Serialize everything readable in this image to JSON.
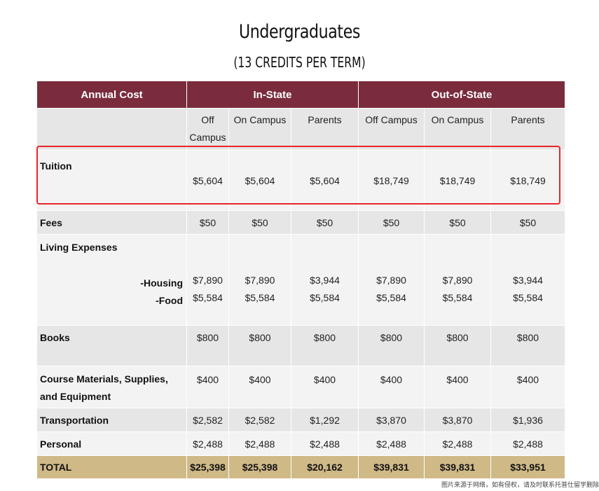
{
  "title": "Undergraduates",
  "subtitle": "(13 CREDITS PER TERM)",
  "header": {
    "annual_cost": "Annual Cost",
    "in_state": "In-State",
    "out_of_state": "Out-of-State"
  },
  "subheader": [
    "Off Campus",
    "On Campus",
    "Parents",
    "Off Campus",
    "On Campus",
    "Parents"
  ],
  "rows": {
    "tuition": {
      "label": "Tuition",
      "values": [
        "$5,604",
        "$5,604",
        "$5,604",
        "$18,749",
        "$18,749",
        "$18,749"
      ]
    },
    "fees": {
      "label": "Fees",
      "values": [
        "$50",
        "$50",
        "$50",
        "$50",
        "$50",
        "$50"
      ]
    },
    "living": {
      "label": "Living Expenses",
      "housing_label": "-Housing",
      "housing": [
        "$7,890",
        "$7,890",
        "$3,944",
        "$7,890",
        "$7,890",
        "$3,944"
      ],
      "food_label": "-Food",
      "food": [
        "$5,584",
        "$5,584",
        "$5,584",
        "$5,584",
        "$5,584",
        "$5,584"
      ]
    },
    "books": {
      "label": "Books",
      "values": [
        "$800",
        "$800",
        "$800",
        "$800",
        "$800",
        "$800"
      ]
    },
    "materials": {
      "label_line1": "Course Materials, Supplies,",
      "label_line2": "and Equipment",
      "values": [
        "$400",
        "$400",
        "$400",
        "$400",
        "$400",
        "$400"
      ]
    },
    "transportation": {
      "label": "Transportation",
      "values": [
        "$2,582",
        "$2,582",
        "$1,292",
        "$3,870",
        "$3,870",
        "$1,936"
      ]
    },
    "personal": {
      "label": "Personal",
      "values": [
        "$2,488",
        "$2,488",
        "$2,488",
        "$2,488",
        "$2,488",
        "$2,488"
      ]
    },
    "total": {
      "label": "TOTAL",
      "values": [
        "$25,398",
        "$25,398",
        "$20,162",
        "$39,831",
        "$39,831",
        "$33,951"
      ]
    }
  },
  "colors": {
    "header_bg": "#7a2c3d",
    "total_bg": "#cfb987",
    "highlight": "#e8262a"
  },
  "watermark": "图片来源于网络，如有侵权，请及时联系托普仕留学删除"
}
